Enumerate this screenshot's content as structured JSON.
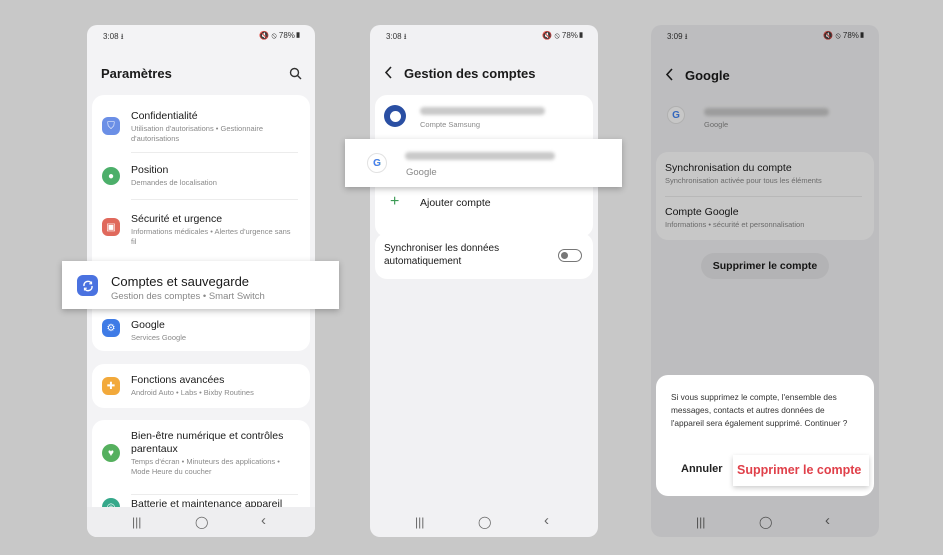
{
  "screen1": {
    "time": "3:08 ⭳",
    "status": "🔇 ⦸ 78%▮",
    "title": "Paramètres",
    "items": [
      {
        "title": "Confidentialité",
        "subtitle": "Utilisation d'autorisations • Gestionnaire d'autorisations",
        "color": "#6b8fe6"
      },
      {
        "title": "Position",
        "subtitle": "Demandes de localisation",
        "color": "#4caf6a"
      },
      {
        "title": "Sécurité et urgence",
        "subtitle": "Informations médicales • Alertes d'urgence sans fil",
        "color": "#e0695c"
      },
      {
        "title": "Comptes et sauvegarde",
        "subtitle": "Gestion des comptes • Smart Switch",
        "color": "#4a72e0"
      },
      {
        "title": "Google",
        "subtitle": "Services Google",
        "color": "#3f7be6"
      },
      {
        "title": "Fonctions avancées",
        "subtitle": "Android Auto • Labs • Bixby Routines",
        "color": "#f2a93b"
      },
      {
        "title": "Bien-être numérique et contrôles parentaux",
        "subtitle": "Temps d'écran • Minuteurs des applications • Mode Heure du coucher",
        "color": "#55b05e"
      },
      {
        "title": "Batterie et maintenance appareil",
        "subtitle": "",
        "color": "#35a88a"
      }
    ]
  },
  "screen2": {
    "time": "3:08 ⭳",
    "status": "🔇 ⦸ 78%▮",
    "title": "Gestion des comptes",
    "account1_type": "Compte Samsung",
    "account2_type": "Google",
    "add_label": "Ajouter compte",
    "sync_label": "Synchroniser les données automatiquement"
  },
  "screen3": {
    "time": "3:09 ⭳",
    "status": "🔇 ⦸ 78%▮",
    "title": "Google",
    "account_type": "Google",
    "sync_title": "Synchronisation du compte",
    "sync_sub": "Synchronisation activée pour tous les éléments",
    "account_title": "Compte Google",
    "account_sub": "Informations • sécurité et personnalisation",
    "remove_button": "Supprimer le compte",
    "dialog_text": "Si vous supprimez le compte, l'ensemble des messages, contacts et autres données de l'appareil sera également supprimé. Continuer ?",
    "cancel_label": "Annuler",
    "confirm_label": "Supprimer le compte"
  },
  "nav": {
    "recents": "|||",
    "home": "◯",
    "back": "‹"
  },
  "icons": {
    "back": "chevron-left-icon",
    "search": "search-icon"
  },
  "colors": {
    "accent_red": "#e0404a",
    "samsung_blue": "#2a4fa3"
  }
}
